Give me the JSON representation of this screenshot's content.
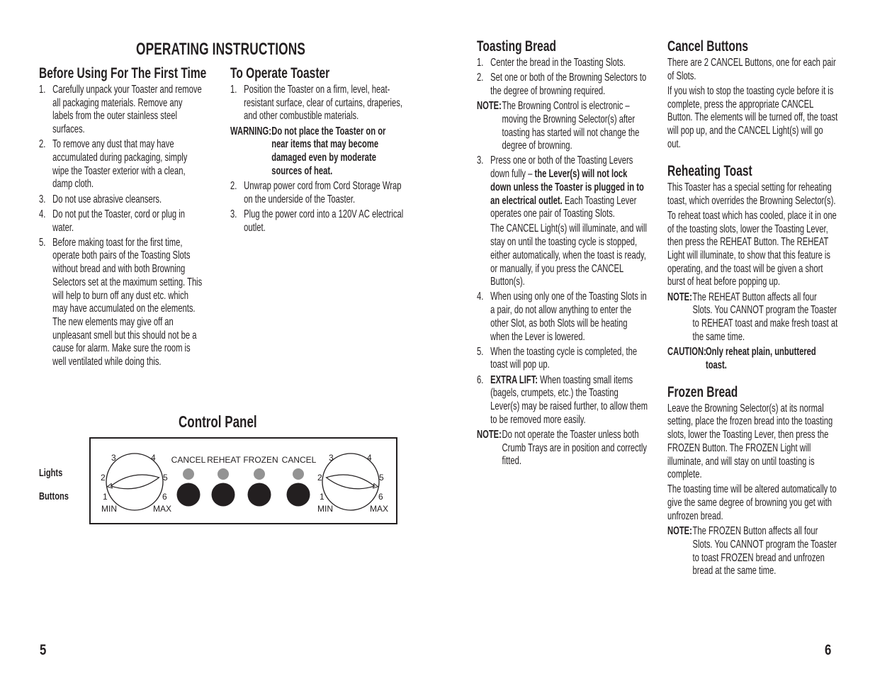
{
  "page_title": "OPERATING INSTRUCTIONS",
  "first_time": {
    "heading": "Before Using For The First Time",
    "items": [
      {
        "num": "1.",
        "text": "Carefully unpack your Toaster and remove all packaging materials. Remove any labels from the outer stainless steel surfaces."
      },
      {
        "num": "2.",
        "text": "To remove any dust that may have accumulated during packaging, simply wipe the Toaster exterior with a clean, damp cloth."
      },
      {
        "num": "3.",
        "text": "Do not use abrasive cleansers."
      },
      {
        "num": "4.",
        "text": "Do not put the Toaster, cord or plug in water."
      },
      {
        "num": "5.",
        "text": "Before making toast for the first time, operate both pairs of the Toasting Slots without bread and with both Browning Selectors set at the maximum setting. This will help to burn off any dust etc. which may have accumulated on the elements. The new elements may give off an unpleasant smell but this should not be a cause for alarm. Make sure the room is well ventilated while doing this."
      }
    ]
  },
  "operate": {
    "heading": "To Operate Toaster",
    "item1": {
      "num": "1.",
      "text": "Position the Toaster on a firm, level, heat-resistant surface, clear of curtains, draperies, and other combustible materials."
    },
    "warning": {
      "label": "WARNING:",
      "text": "Do not place the Toaster on or near items that may become damaged even by moderate sources of heat."
    },
    "item2": {
      "num": "2.",
      "text": "Unwrap power cord from Cord Storage Wrap on the underside of the Toaster."
    },
    "item3": {
      "num": "3.",
      "text": "Plug the power cord into a 120V AC electrical outlet."
    }
  },
  "toasting": {
    "heading": "Toasting Bread",
    "item1": {
      "num": "1.",
      "text": "Center the bread in the Toasting Slots."
    },
    "item2": {
      "num": "2.",
      "text": "Set one or both of the Browning Selectors to the degree of browning required."
    },
    "note1": {
      "label": "NOTE:",
      "text": "The Browning Control is electronic – moving the Browning Selector(s) after toasting has started will not change the degree of browning."
    },
    "item3": {
      "num": "3.",
      "text_a": "Press one or both of the Toasting Levers down fully – ",
      "text_bold": "the Lever(s) will not lock down unless the Toaster is plugged in to an electrical outlet.",
      "text_b": " Each Toasting Lever operates one pair of Toasting Slots.",
      "para2": "The CANCEL Light(s) will illuminate, and will stay on until the toasting cycle is stopped, either automatically, when the toast is ready, or manually, if you press the CANCEL Button(s)."
    },
    "item4": {
      "num": "4.",
      "text": "When using only one of the Toasting Slots in a pair, do not allow anything to enter the other Slot, as both Slots will be heating when the Lever is lowered."
    },
    "item5": {
      "num": "5.",
      "text": "When the toasting cycle is completed, the toast will pop up."
    },
    "item6": {
      "num": "6.",
      "label": "EXTRA LIFT:",
      "text": " When toasting small items (bagels, crumpets, etc.) the Toasting Lever(s) may be raised further, to allow them to be removed more easily."
    },
    "note2": {
      "label": "NOTE:",
      "text": "Do not operate the Toaster unless both Crumb Trays are in position and correctly fitted."
    }
  },
  "cancel": {
    "heading": "Cancel Buttons",
    "para1": "There are 2 CANCEL Buttons, one for each pair of Slots.",
    "para2": "If you wish to stop the toasting cycle before it is complete, press the appropriate CANCEL Button. The elements will be turned off, the toast will pop up, and the CANCEL Light(s) will go out."
  },
  "reheat": {
    "heading": "Reheating Toast",
    "para1": "This Toaster has a special setting for reheating toast, which overrides the Browning Selector(s).",
    "para2": "To reheat toast which has cooled, place it in one of the toasting slots, lower the Toasting Lever, then press the REHEAT Button. The REHEAT Light will illuminate, to show that this feature is operating, and the toast will be given a short burst of heat before popping up.",
    "note": {
      "label": "NOTE:",
      "text": "The REHEAT Button affects all four Slots. You CANNOT program the Toaster to REHEAT toast and make fresh toast at the same time."
    },
    "caution": {
      "label": "CAUTION:",
      "text": "Only reheat plain, unbuttered toast."
    }
  },
  "frozen": {
    "heading": "Frozen Bread",
    "para1": "Leave the Browning Selector(s) at its normal setting, place the frozen bread into the toasting slots, lower the Toasting Lever, then press the FROZEN Button. The FROZEN Light will illuminate, and will stay on until toasting is complete.",
    "para2": "The toasting time will be altered automatically to give the same degree of browning you get with unfrozen bread.",
    "note": {
      "label": "NOTE:",
      "text": "The FROZEN Button affects all four Slots. You CANNOT program the Toaster to toast FROZEN bread and unfrozen bread at the same time."
    }
  },
  "control_panel": {
    "title": "Control Panel",
    "lights_label": "Lights",
    "buttons_label": "Buttons",
    "dial_numbers": [
      "1",
      "2",
      "3",
      "4",
      "5",
      "6"
    ],
    "dial_min": "MIN",
    "dial_max": "MAX",
    "buttons": [
      "CANCEL",
      "REHEAT",
      "FROZEN",
      "CANCEL"
    ],
    "left_dial_setting": 1,
    "right_dial_setting": 6,
    "light_color": "#939393",
    "button_color": "#231f20"
  },
  "page_numbers": {
    "left": "5",
    "right": "6"
  }
}
